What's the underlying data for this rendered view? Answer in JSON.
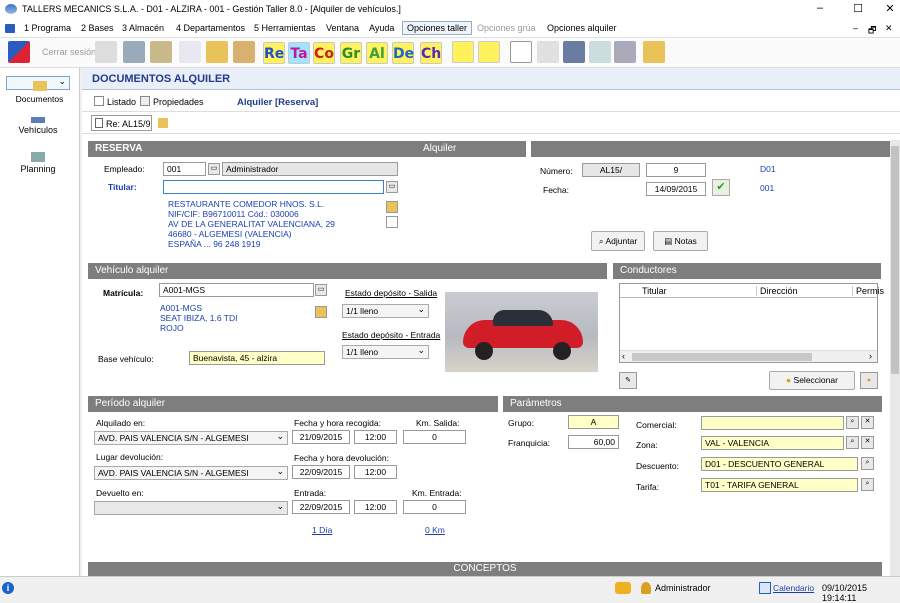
{
  "window": {
    "title": "TALLERS MECANICS S.L.A. - D01 - ALZIRA - 001 - Gestión Taller 8.0 - [Alquiler de vehículos.]",
    "min": "–",
    "max": "☐",
    "close": "✕",
    "min2": "–",
    "restore": "🗗",
    "close2": "✕"
  },
  "menu": [
    "1 Programa",
    "2 Bases",
    "3 Almacén",
    "4 Departamentos",
    "5 Herramientas",
    "Ventana",
    "Ayuda",
    "Opciones taller",
    "Opciones grúa",
    "Opciones alquiler"
  ],
  "toolbar": {
    "close_session": "Cerrar sesión",
    "codes": [
      "Re",
      "Ta",
      "Co",
      "Gr",
      "Al",
      "De",
      "Ch"
    ],
    "code_colors": [
      "#1e50d2",
      "#c8149b",
      "#c81e1e",
      "#2d8c2d",
      "#3ca03c",
      "#1e64c8",
      "#5a28b4"
    ]
  },
  "nav": [
    {
      "label": "Documentos"
    },
    {
      "label": "Vehículos"
    },
    {
      "label": "Planning"
    }
  ],
  "doc": {
    "title": "DOCUMENTOS ALQUILER",
    "listado": "Listado",
    "propiedades": "Propiedades",
    "heading": "Alquiler [Reserva]",
    "tab": "Re: AL15/9"
  },
  "reserva": {
    "header": "RESERVA",
    "header_right": "Alquiler",
    "empleado_label": "Empleado:",
    "empleado_code": "001",
    "empleado_name": "Administrador",
    "titular_label": "Titular:",
    "titular_value": "",
    "client_lines": [
      "RESTAURANTE COMEDOR HNOS. S.L.",
      "NIF/CIF: B96710011   Cód.: 030006",
      "AV DE LA GENERALITAT VALENCIANA, 29",
      "46680 - ALGEMESI (VALENCIA)",
      "ESPAÑA ... 96 248 1919"
    ],
    "numero_label": "Número:",
    "serie": "AL15/",
    "numero": "9",
    "numero_code": "D01",
    "fecha_label": "Fecha:",
    "fecha": "14/09/2015",
    "fecha_code": "001",
    "ajustar": "Adjuntar",
    "notas": "Notas"
  },
  "vehiculo": {
    "header": "Vehículo alquiler",
    "matricula_label": "Matrícula:",
    "matricula": "A001-MGS",
    "lines": [
      "A001-MGS",
      "SEAT IBIZA, 1.6 TDI",
      "ROJO"
    ],
    "base_label": "Base vehículo:",
    "base": "Buenavista, 45 - alzira",
    "salida_label": "Estado depósito - Salida",
    "salida": "1/1 lleno",
    "entrada_label": "Estado depósito - Entrada",
    "entrada": "1/1 lleno"
  },
  "conductores": {
    "header": "Conductores",
    "columns": [
      "Titular",
      "Dirección",
      "Permis"
    ],
    "seleccionar": "Seleccionar"
  },
  "periodo": {
    "header": "Período alquiler",
    "alquilado_label": "Alquilado en:",
    "alquilado": "AVD. PAIS VALENCIA S/N - ALGEMESI",
    "recogida_label": "Fecha y hora recogida:",
    "recogida_fecha": "21/09/2015",
    "recogida_hora": "12:00",
    "km_salida_label": "Km. Salida:",
    "km_salida": "0",
    "lugar_label": "Lugar devolución:",
    "lugar": "AVD. PAIS VALENCIA S/N - ALGEMESI",
    "devolucion_label": "Fecha y hora devolución:",
    "devolucion_fecha": "22/09/2015",
    "devolucion_hora": "12:00",
    "devuelto_label": "Devuelto en:",
    "devuelto": "",
    "entrada_label": "Entrada:",
    "entrada_fecha": "22/09/2015",
    "entrada_hora": "12:00",
    "km_entrada_label": "Km. Entrada:",
    "km_entrada": "0",
    "dias": "1 Día",
    "km": "0 Km"
  },
  "parametros": {
    "header": "Parámetros",
    "grupo_label": "Grupo:",
    "grupo": "A",
    "franquicia_label": "Franquicia:",
    "franquicia": "60,00",
    "comercial_label": "Comercial:",
    "comercial": "",
    "zona_label": "Zona:",
    "zona": "VAL - VALENCIA",
    "descuento_label": "Descuento:",
    "descuento": "D01 - DESCUENTO GENERAL",
    "tarifa_label": "Tarifa:",
    "tarifa": "T01 - TARIFA GENERAL"
  },
  "conceptos": {
    "header": "CONCEPTOS"
  },
  "status": {
    "user": "Administrador",
    "calendar": "Calendario",
    "datetime": "09/10/2015 19:14:11"
  }
}
